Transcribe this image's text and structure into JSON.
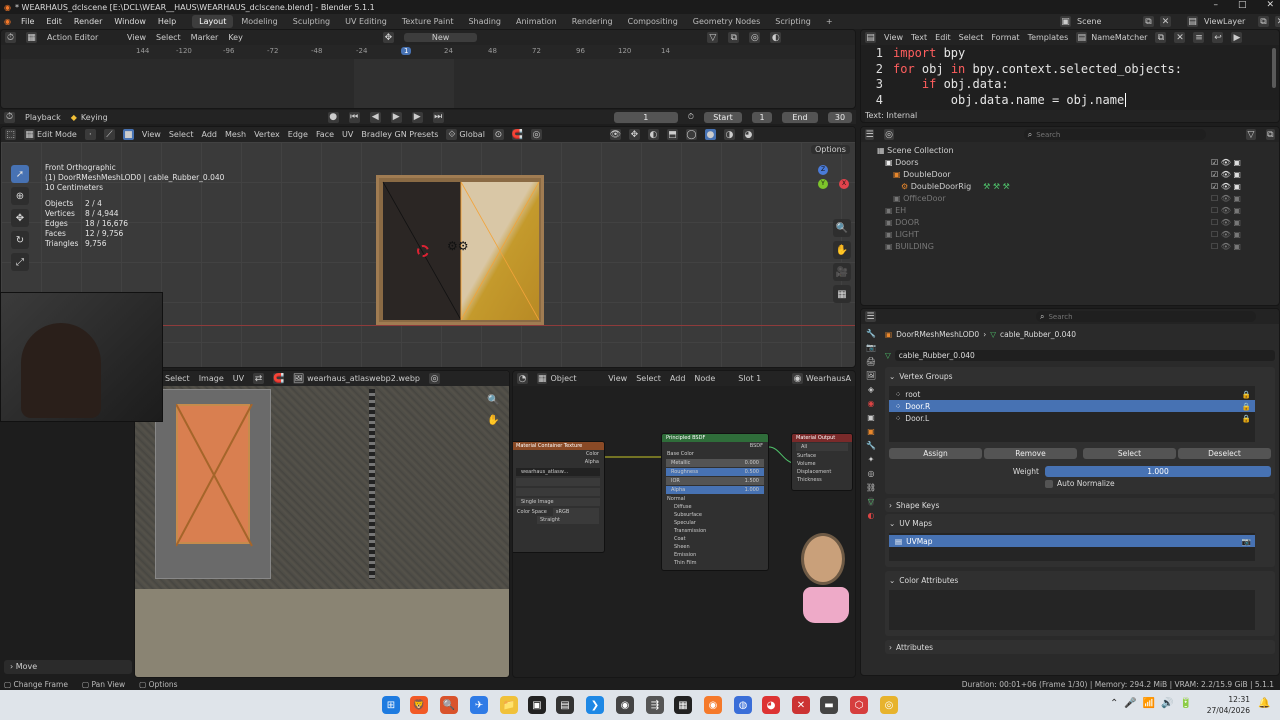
{
  "title": "* WEARHAUS_dclscene [E:\\DCL\\WEAR__HAUS\\WEARHAUS_dclscene.blend] - Blender 5.1.1",
  "window_controls": [
    "–",
    "□",
    "✕"
  ],
  "menu": [
    "File",
    "Edit",
    "Render",
    "Window",
    "Help"
  ],
  "workspaces": [
    "Layout",
    "Modeling",
    "Sculpting",
    "UV Editing",
    "Texture Paint",
    "Shading",
    "Animation",
    "Rendering",
    "Compositing",
    "Geometry Nodes",
    "Scripting"
  ],
  "scene": {
    "label": "Scene",
    "view_layer": "ViewLayer"
  },
  "action_editor": {
    "mode": "Action Editor",
    "menus": [
      "View",
      "Select",
      "Marker",
      "Key"
    ],
    "new_label": "New",
    "ruler": [
      "144",
      "-120",
      "-96",
      "-72",
      "-48",
      "-24",
      "1",
      "24",
      "48",
      "72",
      "96",
      "120",
      "14"
    ],
    "current_frame": "1"
  },
  "playback": {
    "playback": "Playback",
    "keying": "Keying",
    "frame": "1",
    "start_label": "Start",
    "start": "1",
    "end_label": "End",
    "end": "30"
  },
  "text_editor": {
    "menus": [
      "View",
      "Text",
      "Edit",
      "Select",
      "Format",
      "Templates"
    ],
    "file": "NameMatcher",
    "status": "Text: Internal",
    "lines": [
      {
        "n": "1",
        "kw": "import",
        "rest": " bpy",
        "indent": ""
      },
      {
        "n": "2",
        "kw": "for",
        "rest": " obj ",
        "kw2": "in",
        "rest2": " bpy.context.selected_objects:",
        "indent": ""
      },
      {
        "n": "3",
        "kw": "if",
        "rest": " obj.data:",
        "indent": "    "
      },
      {
        "n": "4",
        "kw": "",
        "rest": "obj.data.name = obj.name",
        "indent": "        "
      }
    ]
  },
  "viewport": {
    "mode": "Edit Mode",
    "menus": [
      "View",
      "Select",
      "Add",
      "Mesh",
      "Vertex",
      "Edge",
      "Face",
      "UV",
      "Bradley GN Presets"
    ],
    "transform": "Global",
    "options": "Options",
    "view_name": "Front Orthographic",
    "object_line": "(1) DoorRMeshMeshLOD0 | cable_Rubber_0.040",
    "scale": "10 Centimeters",
    "stats": [
      {
        "k": "Objects",
        "v": "2 / 4"
      },
      {
        "k": "Vertices",
        "v": "8 / 4,944"
      },
      {
        "k": "Edges",
        "v": "18 / 16,676"
      },
      {
        "k": "Faces",
        "v": "12 / 9,756"
      },
      {
        "k": "Triangles",
        "v": "9,756"
      }
    ],
    "gizmo": [
      "Z",
      "Y",
      "X"
    ]
  },
  "outliner": {
    "search_placeholder": "Search",
    "items": [
      {
        "label": "Scene Collection",
        "depth": 0,
        "dim": false
      },
      {
        "label": "Doors",
        "depth": 1,
        "dim": false
      },
      {
        "label": "DoubleDoor",
        "depth": 2,
        "dim": false
      },
      {
        "label": "DoubleDoorRig",
        "depth": 3,
        "dim": false
      },
      {
        "label": "OfficeDoor",
        "depth": 2,
        "dim": true
      },
      {
        "label": "EH",
        "depth": 1,
        "dim": true
      },
      {
        "label": "DOOR",
        "depth": 1,
        "dim": true
      },
      {
        "label": "LIGHT",
        "depth": 1,
        "dim": true
      },
      {
        "label": "BUILDING",
        "depth": 1,
        "dim": true
      }
    ]
  },
  "uv_editor": {
    "menus": [
      "Select",
      "Image",
      "UV"
    ],
    "image": "wearhaus_atlaswebp2.webp",
    "move_label": "Move"
  },
  "node_editor": {
    "object_label": "Object",
    "menus": [
      "View",
      "Select",
      "Add",
      "Node"
    ],
    "slot": "Slot 1",
    "material": "WearhausA",
    "image_node": {
      "title": "Material Container Texture",
      "rows": [
        "Color",
        "Alpha",
        "wearhaus_atlasw...",
        "Single Image",
        "Color Space",
        "sRGB",
        "Straight"
      ]
    },
    "bsdf_node": {
      "title": "Principled BSDF",
      "out": "BSDF",
      "rows": [
        {
          "k": "Base Color",
          "v": ""
        },
        {
          "k": "Metallic",
          "v": "0.000"
        },
        {
          "k": "Roughness",
          "v": "0.500"
        },
        {
          "k": "IOR",
          "v": "1.500"
        },
        {
          "k": "Alpha",
          "v": "1.000"
        },
        {
          "k": "Normal",
          "v": ""
        },
        {
          "k": "Diffuse",
          "v": ""
        },
        {
          "k": "Subsurface",
          "v": ""
        },
        {
          "k": "Specular",
          "v": ""
        },
        {
          "k": "Transmission",
          "v": ""
        },
        {
          "k": "Coat",
          "v": ""
        },
        {
          "k": "Sheen",
          "v": ""
        },
        {
          "k": "Emission",
          "v": ""
        },
        {
          "k": "Thin Film",
          "v": ""
        }
      ]
    },
    "output_node": {
      "title": "Material Output",
      "rows": [
        "All",
        "Surface",
        "Volume",
        "Displacement",
        "Thickness"
      ]
    }
  },
  "properties": {
    "search_placeholder": "Search",
    "breadcrumb_mesh": "DoorRMeshMeshLOD0",
    "breadcrumb_data": "cable_Rubber_0.040",
    "data_name": "cable_Rubber_0.040",
    "vertex_groups_label": "Vertex Groups",
    "vertex_groups": [
      "root",
      "Door.R",
      "Door.L"
    ],
    "selected_group": "Door.R",
    "buttons": [
      "Assign",
      "Remove",
      "Select",
      "Deselect"
    ],
    "weight_label": "Weight",
    "weight": "1.000",
    "auto_normalize": "Auto Normalize",
    "shape_keys": "Shape Keys",
    "uv_maps": "UV Maps",
    "uv_map_item": "UVMap",
    "color_attributes": "Color Attributes",
    "attributes": "Attributes"
  },
  "status_bar": {
    "left": [
      "Change Frame",
      "Pan View",
      "Options"
    ],
    "right": "Duration: 00:01+06 (Frame 1/30) | Memory: 294.2 MiB | VRAM: 2.2/15.9 GiB | 5.1.1"
  },
  "taskbar": {
    "time": "12:31",
    "date": "27/04/2026"
  },
  "colors": {
    "accent": "#4772b3",
    "playhead": "#4772b3",
    "bsdf_header": "#2f6d3a",
    "texture_header": "#8a4a26",
    "output_header": "#7a2a2a"
  }
}
